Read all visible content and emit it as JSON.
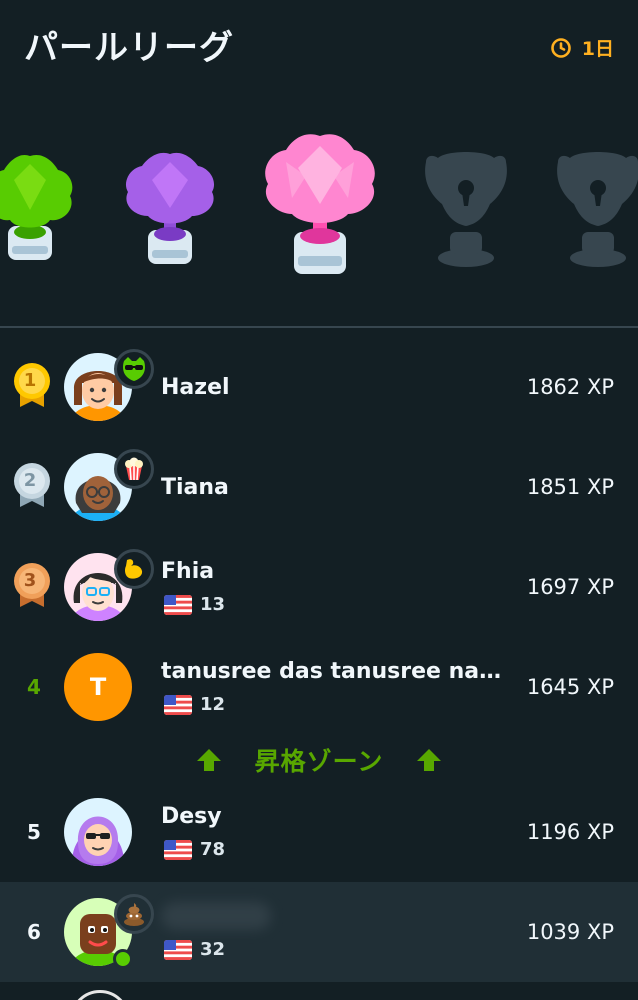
{
  "header": {
    "title": "パールリーグ",
    "timer_label": "1日"
  },
  "trophies": [
    {
      "name": "emerald",
      "state": "completed",
      "color": "#58cc02"
    },
    {
      "name": "amethyst",
      "state": "completed",
      "color": "#a560e8"
    },
    {
      "name": "pearl",
      "state": "current",
      "color": "#ff86d0"
    },
    {
      "name": "locked-1",
      "state": "locked",
      "color": "#37464f"
    },
    {
      "name": "locked-2",
      "state": "locked",
      "color": "#37464f"
    }
  ],
  "promotion_zone_label": "昇格ゾーン",
  "leaderboard": [
    {
      "rank": "1",
      "name": "Hazel",
      "xp": "1862 XP",
      "medal": "gold",
      "badge": "sunglasses-owl-icon"
    },
    {
      "rank": "2",
      "name": "Tiana",
      "xp": "1851 XP",
      "medal": "silver",
      "badge": "popcorn-icon"
    },
    {
      "rank": "3",
      "name": "Fhia",
      "streak": "13",
      "xp": "1697 XP",
      "medal": "bronze",
      "badge": "muscle-icon"
    },
    {
      "rank": "4",
      "name": "tanusree das tanusree nas...",
      "avatar_letter": "T",
      "streak": "12",
      "xp": "1645 XP"
    },
    {
      "rank": "5",
      "name": "Desy",
      "streak": "78",
      "xp": "1196 XP"
    },
    {
      "rank": "6",
      "streak": "32",
      "xp": "1039 XP",
      "badge": "poop-icon",
      "is_current_user": true
    }
  ]
}
